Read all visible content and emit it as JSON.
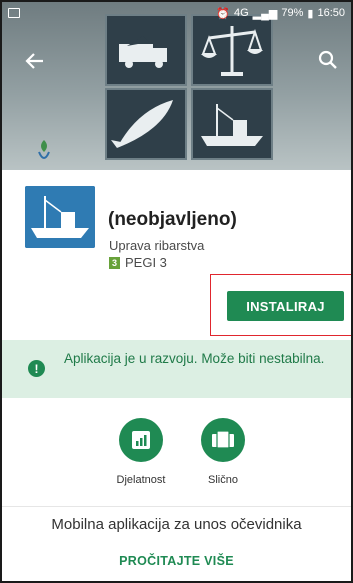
{
  "status_bar": {
    "network": "4G",
    "battery": "79%",
    "time": "16:50"
  },
  "header": {
    "back_icon": "arrow-back-icon",
    "search_icon": "search-icon"
  },
  "app": {
    "name": "(neobjavljeno)",
    "developer": "Uprava ribarstva",
    "rating_badge": "3",
    "rating_label": "PEGI 3",
    "install_label": "INSTALIRAJ"
  },
  "notice": {
    "icon": "exclamation-icon",
    "text": "Aplikacija je u razvoju. Može biti nestabilna."
  },
  "features": [
    {
      "label": "Djelatnost",
      "icon": "bar-chart-icon"
    },
    {
      "label": "Slično",
      "icon": "cards-icon"
    }
  ],
  "description": "Mobilna aplikacija za unos očevidnika",
  "read_more": "PROČITAJTE VIŠE",
  "colors": {
    "accent": "#1f8a53",
    "notice_bg": "#dcefe3",
    "highlight_border": "#e0262e",
    "tile_bg": "#2f3f49",
    "app_icon_bg": "#2f7bb3"
  }
}
